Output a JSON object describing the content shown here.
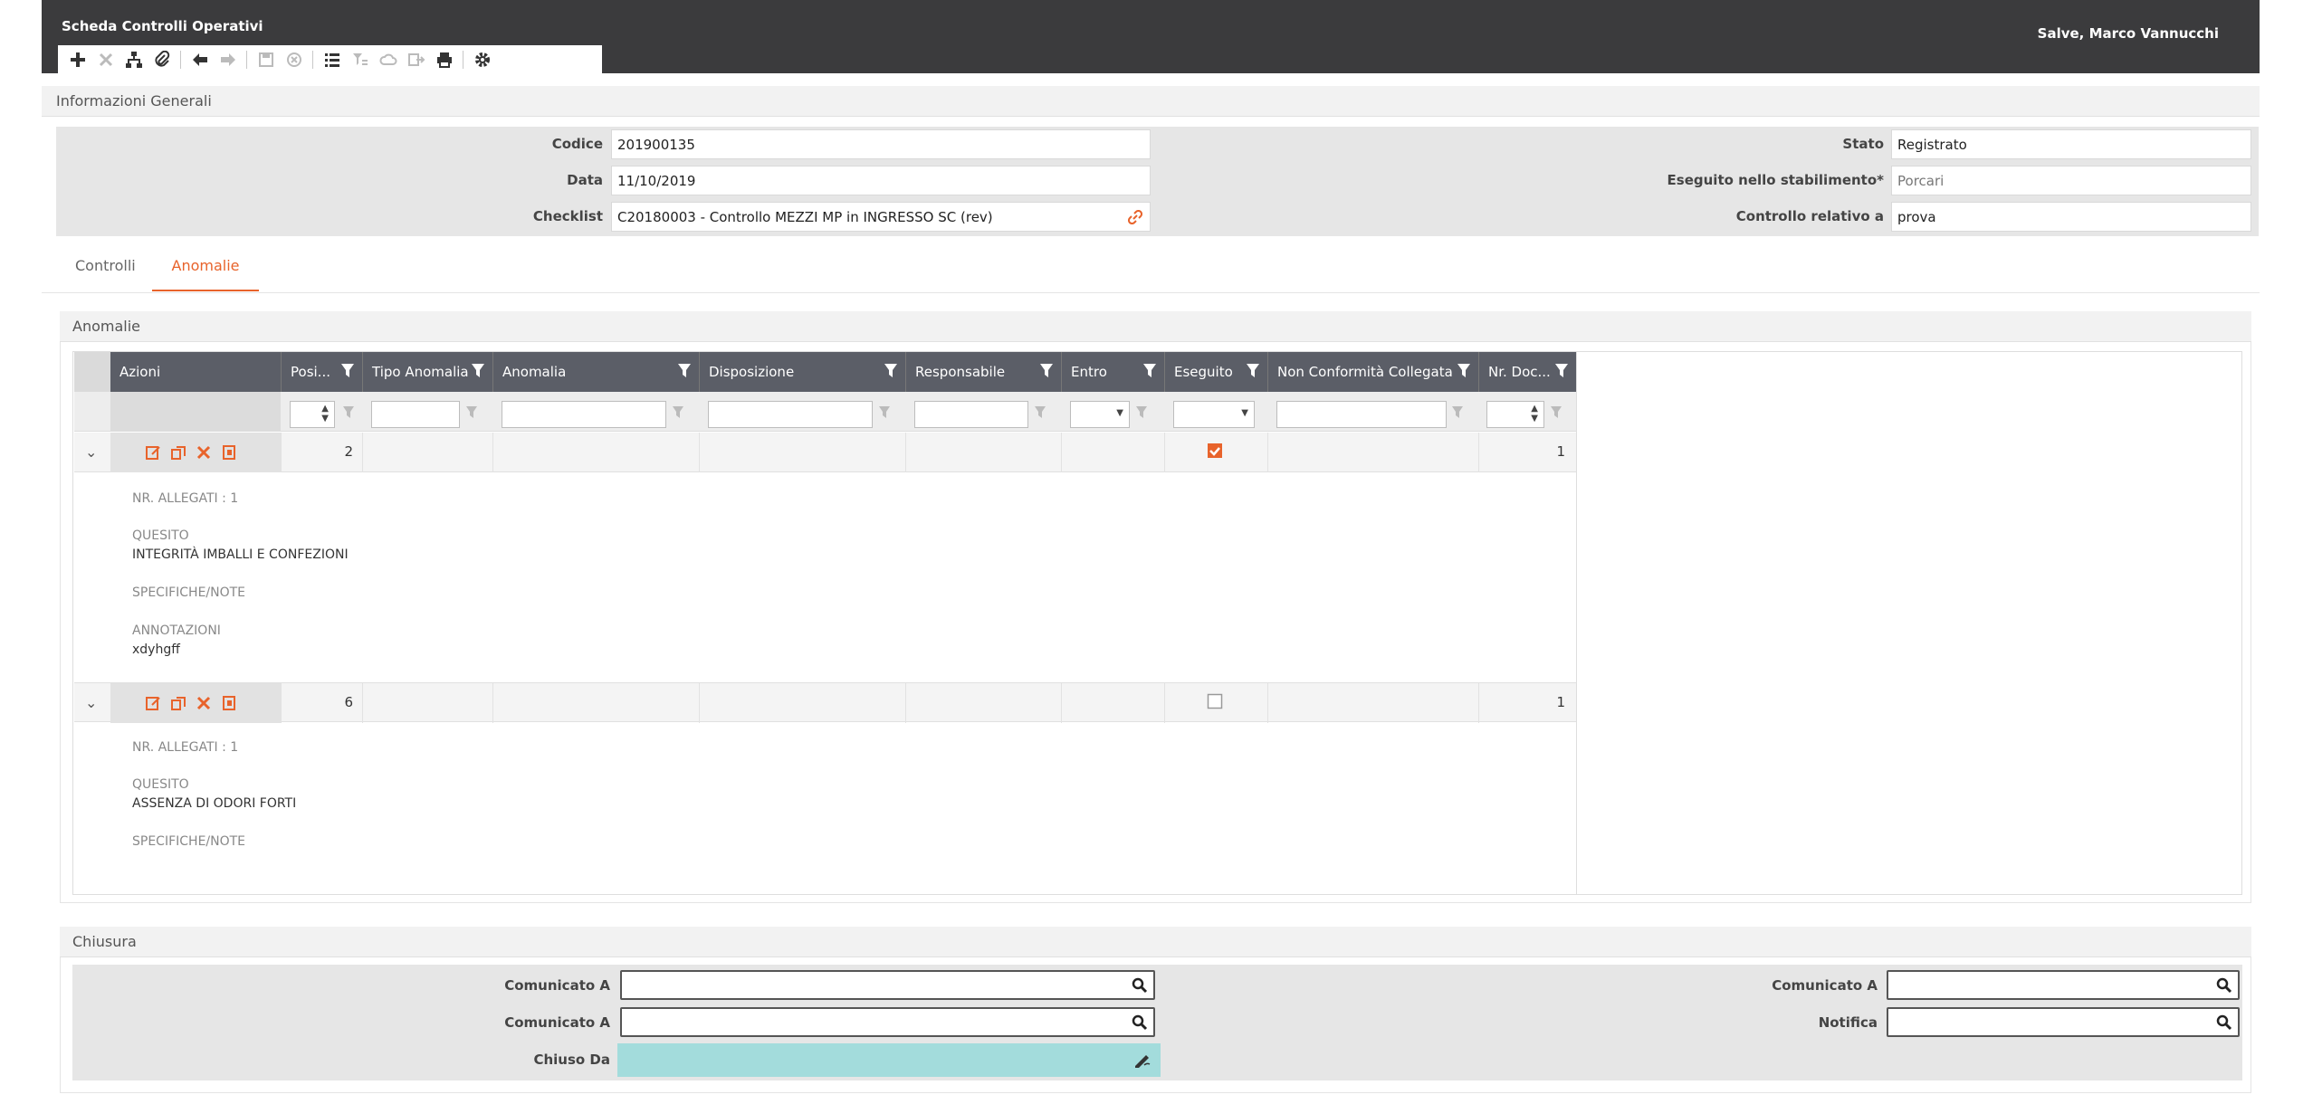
{
  "header": {
    "title": "Scheda Controlli Operativi",
    "greeting": "Salve, Marco Vannucchi"
  },
  "toolbar": {
    "buttons": [
      {
        "icon": "plus-icon",
        "enabled": true
      },
      {
        "icon": "close-icon",
        "enabled": false
      },
      {
        "icon": "hierarchy-icon",
        "enabled": true
      },
      {
        "icon": "paperclip-icon",
        "enabled": true
      },
      {
        "icon": "arrow-left-icon",
        "enabled": true
      },
      {
        "icon": "arrow-right-icon",
        "enabled": false
      },
      {
        "icon": "save-icon",
        "enabled": false
      },
      {
        "icon": "cancel-circle-icon",
        "enabled": false
      },
      {
        "icon": "list-icon",
        "enabled": true
      },
      {
        "icon": "filter-list-icon",
        "enabled": false
      },
      {
        "icon": "cloud-settings-icon",
        "enabled": false
      },
      {
        "icon": "export-icon",
        "enabled": false
      },
      {
        "icon": "print-icon",
        "enabled": true
      },
      {
        "icon": "gear-icon",
        "enabled": true
      }
    ]
  },
  "info": {
    "section_title": "Informazioni Generali",
    "codice_label": "Codice",
    "codice_value": "201900135",
    "data_label": "Data",
    "data_value": "11/10/2019",
    "checklist_label": "Checklist",
    "checklist_value": "C20180003 - Controllo MEZZI MP in INGRESSO SC (rev)",
    "stato_label": "Stato",
    "stato_value": "Registrato",
    "stabilimento_label": "Eseguito nello stabilimento*",
    "stabilimento_value": "Porcari",
    "relativo_label": "Controllo relativo a",
    "relativo_value": "prova"
  },
  "tabs": [
    {
      "label": "Controlli",
      "active": false
    },
    {
      "label": "Anomalie",
      "active": true
    }
  ],
  "anomalie": {
    "section_title": "Anomalie",
    "columns": [
      "Azioni",
      "Posi...",
      "Tipo Anomalia",
      "Anomalia",
      "Disposizione",
      "Responsabile",
      "Entro",
      "Eseguito",
      "Non Conformità Collegata",
      "Nr. Doc..."
    ],
    "rows": [
      {
        "posizione": "2",
        "eseguito": true,
        "nr_doc": "1",
        "nr_allegati": "NR. ALLEGATI : 1",
        "quesito_label": "QUESITO",
        "quesito": "INTEGRITÀ IMBALLI E CONFEZIONI",
        "specifiche_label": "SPECIFICHE/NOTE",
        "annotazioni_label": "ANNOTAZIONI",
        "annotazioni": "xdyhgff"
      },
      {
        "posizione": "6",
        "eseguito": false,
        "nr_doc": "1",
        "nr_allegati": "NR. ALLEGATI : 1",
        "quesito_label": "QUESITO",
        "quesito": "ASSENZA DI ODORI FORTI",
        "specifiche_label": "SPECIFICHE/NOTE"
      }
    ]
  },
  "chiusura": {
    "section_title": "Chiusura",
    "comunicato1_label": "Comunicato A",
    "comunicato2_label": "Comunicato A",
    "comunicato3_label": "Comunicato A",
    "notifica_label": "Notifica",
    "chiuso_label": "Chiuso Da",
    "chiuso_color": "#a3dcdc"
  },
  "colors": {
    "accent": "#e8632b",
    "header_bg": "#3b3b3d",
    "grid_header_bg": "#5b5e67"
  }
}
